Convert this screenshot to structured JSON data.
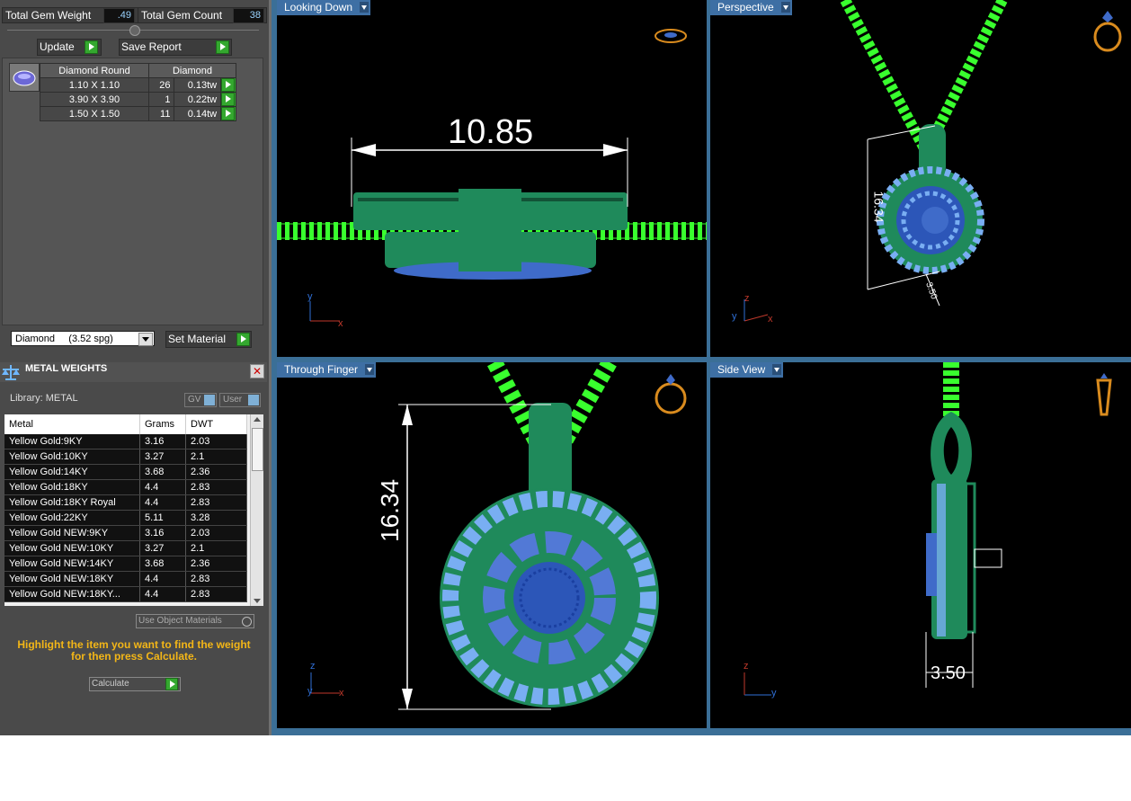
{
  "gems": {
    "total_weight_label": "Total Gem Weight",
    "total_weight_value": ".49",
    "total_count_label": "Total Gem Count",
    "total_count_value": "38",
    "update_label": "Update",
    "save_report_label": "Save Report",
    "table_headers": [
      "Diamond Round",
      "Diamond"
    ],
    "rows": [
      {
        "size": "1.10 X 1.10",
        "count": "26",
        "weight": "0.13tw"
      },
      {
        "size": "3.90 X 3.90",
        "count": "1",
        "weight": "0.22tw"
      },
      {
        "size": "1.50 X 1.50",
        "count": "11",
        "weight": "0.14tw"
      }
    ],
    "material_select": "Diamond     (3.52 spg)",
    "set_material_label": "Set Material"
  },
  "metal": {
    "title": "METAL WEIGHTS",
    "library_label": "Library: METAL",
    "gv_label": "GV",
    "user_label": "User",
    "headers": [
      "Metal",
      "Grams",
      "DWT"
    ],
    "rows": [
      {
        "metal": "Yellow Gold:9KY",
        "grams": "3.16",
        "dwt": "2.03"
      },
      {
        "metal": "Yellow Gold:10KY",
        "grams": "3.27",
        "dwt": "2.1"
      },
      {
        "metal": "Yellow Gold:14KY",
        "grams": "3.68",
        "dwt": "2.36"
      },
      {
        "metal": "Yellow Gold:18KY",
        "grams": "4.4",
        "dwt": "2.83"
      },
      {
        "metal": "Yellow Gold:18KY Royal",
        "grams": "4.4",
        "dwt": "2.83"
      },
      {
        "metal": "Yellow Gold:22KY",
        "grams": "5.11",
        "dwt": "3.28"
      },
      {
        "metal": "Yellow Gold NEW:9KY",
        "grams": "3.16",
        "dwt": "2.03"
      },
      {
        "metal": "Yellow Gold NEW:10KY",
        "grams": "3.27",
        "dwt": "2.1"
      },
      {
        "metal": "Yellow Gold NEW:14KY",
        "grams": "3.68",
        "dwt": "2.36"
      },
      {
        "metal": "Yellow Gold NEW:18KY",
        "grams": "4.4",
        "dwt": "2.83"
      },
      {
        "metal": "Yellow Gold NEW:18KY...",
        "grams": "4.4",
        "dwt": "2.83"
      }
    ],
    "use_object_materials": "Use Object Materials",
    "hint": "Highlight the item you want to find the weight for then press Calculate.",
    "calculate_label": "Calculate"
  },
  "viewports": {
    "top_left": {
      "label": "Looking Down",
      "dimension": "10.85"
    },
    "top_right": {
      "label": "Perspective",
      "dimension": "16.34",
      "dimension2": "3.50"
    },
    "bottom_left": {
      "label": "Through Finger",
      "dimension": "16.34"
    },
    "bottom_right": {
      "label": "Side View",
      "dimension": "3.50"
    }
  },
  "axes": {
    "x": "x",
    "y": "y",
    "z": "z"
  },
  "colors": {
    "metal": "#1f8a5b",
    "chain": "#39ff2e",
    "stone": "#79aef2",
    "viewport_tab": "#3e6fa4",
    "hint": "#f3b617"
  }
}
